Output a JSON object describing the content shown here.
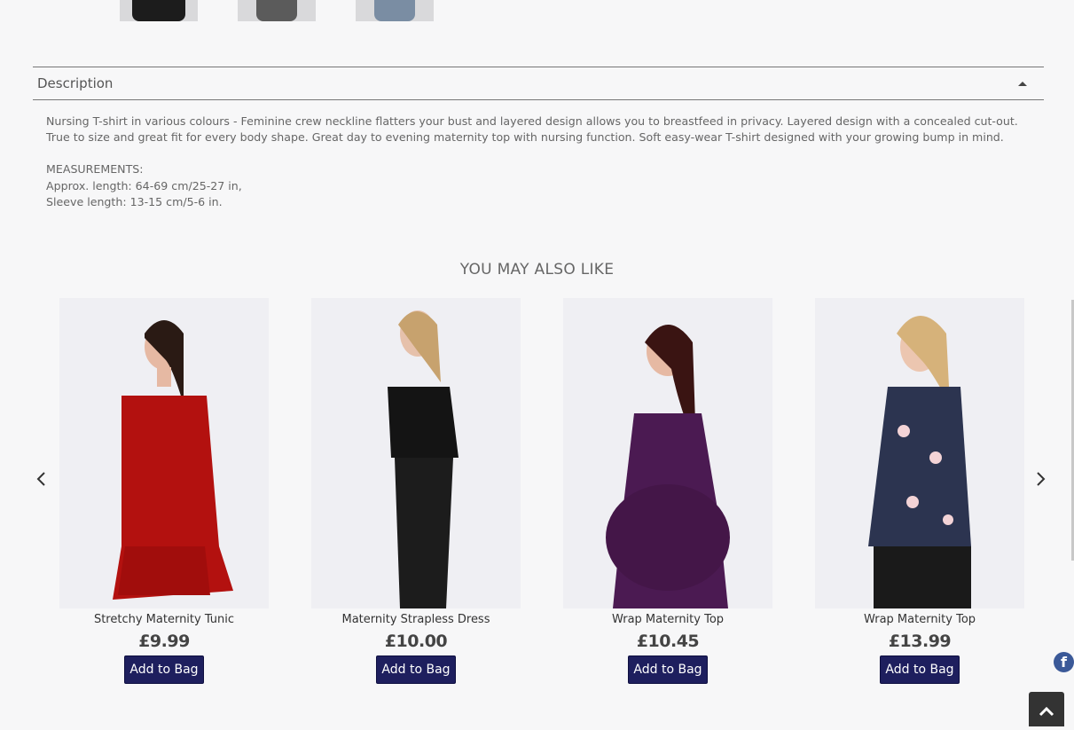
{
  "description": {
    "title": "Description",
    "body": "Nursing T-shirt in various colours - Feminine crew neckline flatters your bust and layered design allows you to breastfeed in privacy. Layered design with a concealed cut-out. True to size and great fit for every body shape. Great day to evening maternity top with nursing function. Soft easy-wear T-shirt designed with your growing bump in mind.",
    "measurements_heading": "MEASUREMENTS:",
    "length": "Approx. length: 64-69 cm/25-27 in,",
    "sleeve": "Sleeve length: 13-15 cm/5-6 in."
  },
  "recommendations": {
    "title": "YOU MAY ALSO LIKE",
    "products": [
      {
        "name": "Stretchy Maternity Tunic",
        "price": "£9.99",
        "button": "Add to Bag",
        "color": "#b3110f"
      },
      {
        "name": "Maternity Strapless Dress",
        "price": "£10.00",
        "button": "Add to Bag",
        "color": "#141414"
      },
      {
        "name": "Wrap Maternity Top",
        "price": "£10.45",
        "button": "Add to Bag",
        "color": "#4b1a52"
      },
      {
        "name": "Wrap Maternity Top",
        "price": "£13.99",
        "button": "Add to Bag",
        "color": "#2c3450"
      }
    ]
  },
  "social": {
    "facebook_icon": "f"
  },
  "colors": {
    "button_bg": "#1e1f5e",
    "page_bg": "#f7f7f8"
  }
}
